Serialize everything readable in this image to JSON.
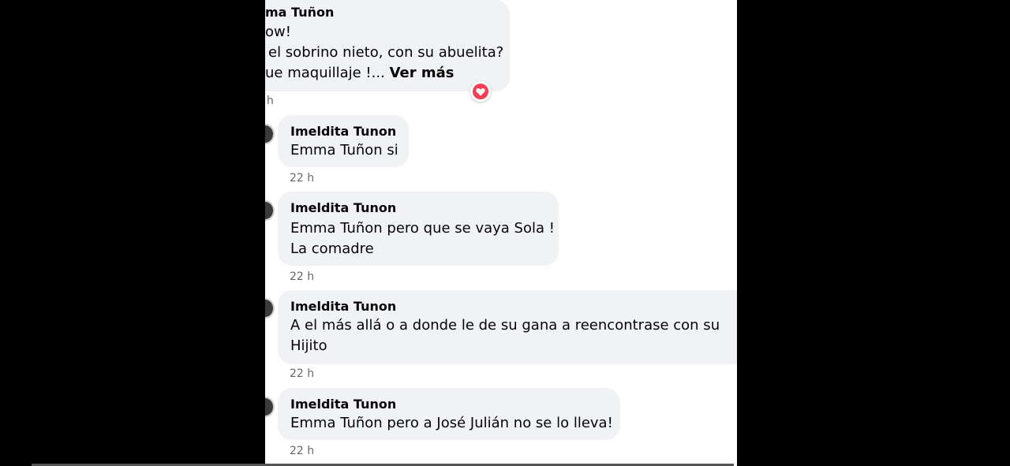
{
  "comments": [
    {
      "author": "ma Tuñon",
      "lines": [
        "ow!",
        "el sobrino nieto, con su abuelita?",
        "ue maquillaje !..."
      ],
      "more_label": "Ver más",
      "time": "h"
    },
    {
      "author": "Imeldita Tunon",
      "lines": [
        "Emma Tuñon si"
      ],
      "time": "22 h"
    },
    {
      "author": "Imeldita Tunon",
      "lines": [
        "Emma Tuñon pero que se vaya Sola !",
        "La comadre"
      ],
      "time": "22 h"
    },
    {
      "author": "Imeldita Tunon",
      "lines": [
        "A el más allá o a donde le de su gana a reencontrase con su",
        "Hijito"
      ],
      "time": "22 h"
    },
    {
      "author": "Imeldita Tunon",
      "lines": [
        "Emma Tuñon pero a José Julián no se lo lleva!"
      ],
      "time": "22 h"
    }
  ],
  "reaction": {
    "icon": "heart-icon",
    "color": "#f33e58"
  }
}
